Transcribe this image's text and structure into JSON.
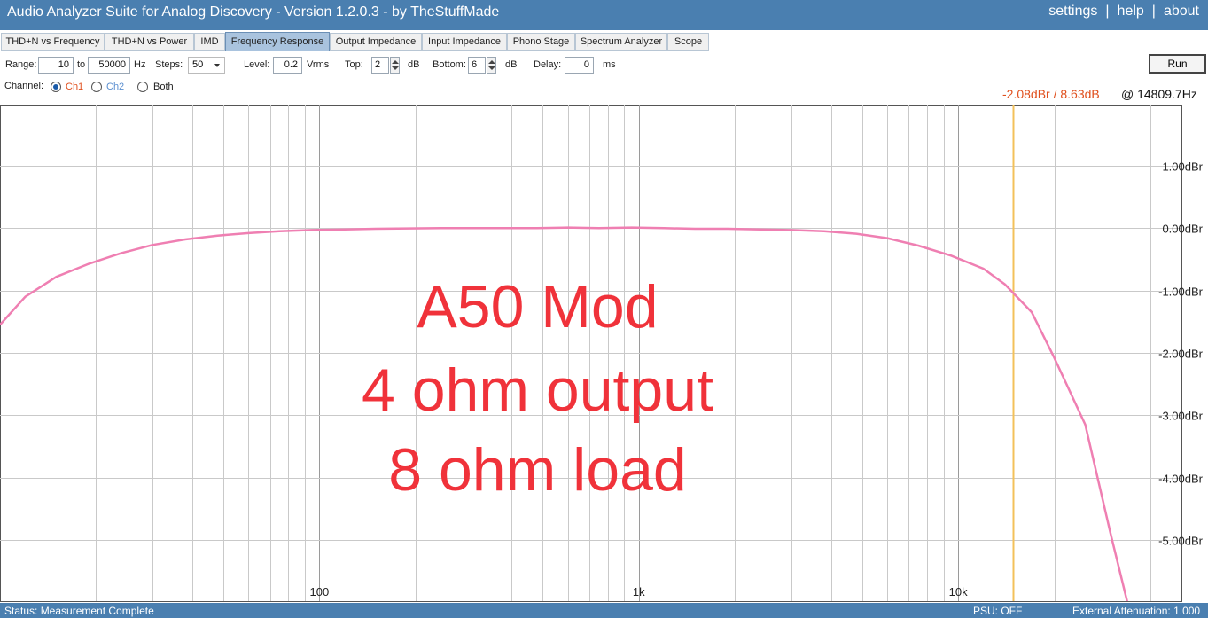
{
  "window": {
    "title": "Audio Analyzer Suite for Analog Discovery - Version   1.2.0.3   - by TheStuffMade",
    "links": [
      "settings",
      "help",
      "about"
    ]
  },
  "tabs": [
    {
      "label": "THD+N vs Frequency",
      "active": false
    },
    {
      "label": "THD+N vs Power",
      "active": false
    },
    {
      "label": "IMD",
      "active": false
    },
    {
      "label": "Frequency Response",
      "active": true
    },
    {
      "label": "Output Impedance",
      "active": false
    },
    {
      "label": "Input Impedance",
      "active": false
    },
    {
      "label": "Phono Stage",
      "active": false
    },
    {
      "label": "Spectrum Analyzer",
      "active": false
    },
    {
      "label": "Scope",
      "active": false
    }
  ],
  "controls": {
    "range_label": "Range:",
    "range_from": "10",
    "to_label": "to",
    "range_to": "50000",
    "hz_label": "Hz",
    "steps_label": "Steps:",
    "steps_value": "50",
    "level_label": "Level:",
    "level_value": "0.2",
    "level_unit": "Vrms",
    "top_label": "Top:",
    "top_value": "2",
    "top_unit": "dB",
    "bottom_label": "Bottom:",
    "bottom_value": "6",
    "bottom_unit": "dB",
    "delay_label": "Delay:",
    "delay_value": "0",
    "delay_unit": "ms",
    "run_label": "Run",
    "channel_label": "Channel:",
    "channels": [
      {
        "label": "Ch1",
        "selected": true,
        "color": "#e0501e"
      },
      {
        "label": "Ch2",
        "selected": false,
        "color": "#5b8fd0"
      },
      {
        "label": "Both",
        "selected": false,
        "color": "#222222"
      }
    ]
  },
  "cursor": {
    "value": "-2.08dBr / 8.63dB",
    "freq": "@ 14809.7Hz",
    "x_hz": 14809.7,
    "value_color": "#e0501e",
    "line_color": "#f3c15a"
  },
  "overlay": {
    "line1": "A50 Mod",
    "line2": "4 ohm output",
    "line3": "8 ohm load"
  },
  "status": {
    "left": "Status: Measurement Complete",
    "psu": "PSU: OFF",
    "attenuation": "External Attenuation: 1.000"
  },
  "chart_data": {
    "type": "line",
    "xscale": "log",
    "xlim": [
      10,
      50000
    ],
    "ylim": [
      -5.98,
      1.98
    ],
    "yticks": [
      1,
      0,
      -1,
      -2,
      -3,
      -4,
      -5
    ],
    "ytick_labels": [
      "1.00dBr",
      "0.00dBr",
      "-1.00dBr",
      "-2.00dBr",
      "-3.00dBr",
      "-4.00dBr",
      "-5.00dBr"
    ],
    "xticks": [
      100,
      1000,
      10000
    ],
    "xtick_labels": [
      "100",
      "1k",
      "10k"
    ],
    "grid": true,
    "series": [
      {
        "color": "#ef7fb2",
        "x": [
          10,
          12,
          15,
          19,
          24,
          30,
          38,
          48,
          60,
          75,
          95,
          120,
          150,
          190,
          240,
          300,
          380,
          480,
          600,
          750,
          950,
          1200,
          1500,
          1900,
          2400,
          3000,
          3800,
          4800,
          6000,
          7500,
          9500,
          12000,
          14000,
          17000,
          20000,
          25000,
          30000,
          35000
        ],
        "y": [
          -1.55,
          -1.1,
          -0.78,
          -0.57,
          -0.4,
          -0.27,
          -0.18,
          -0.12,
          -0.08,
          -0.05,
          -0.03,
          -0.02,
          -0.01,
          -0.005,
          0,
          0,
          0,
          0,
          0.01,
          0,
          0.01,
          0,
          -0.01,
          -0.01,
          -0.02,
          -0.03,
          -0.05,
          -0.09,
          -0.16,
          -0.28,
          -0.44,
          -0.65,
          -0.9,
          -1.35,
          -2.08,
          -3.15,
          -4.9,
          -6.3
        ]
      }
    ]
  }
}
